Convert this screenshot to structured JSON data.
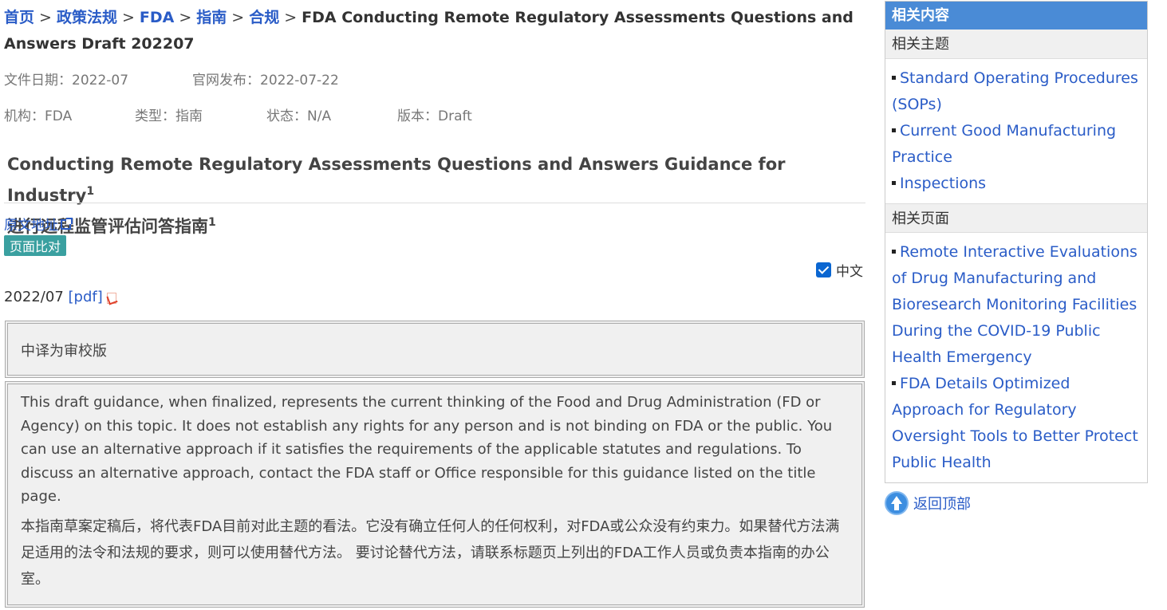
{
  "breadcrumb": {
    "home": "首页",
    "policy": "政策法规",
    "fda": "FDA",
    "guide": "指南",
    "compliance": "合规",
    "sep": ">",
    "current": "FDA Conducting Remote Regulatory Assessments Questions and Answers Draft 202207"
  },
  "meta": {
    "doc_date": "文件日期：2022-07",
    "published": "官网发布：2022-07-22",
    "agency": "机构：FDA",
    "type": "类型：指南",
    "status": "状态：N/A",
    "version": "版本：Draft"
  },
  "doc": {
    "title_en": "Conducting Remote Regulatory Assessments Questions and Answers Guidance for Industry",
    "title_zh": "进行远程监管评估问答指南",
    "footnote": "1",
    "original_link": "原文地址",
    "compare_button": "页面比对",
    "lang_label": "中文",
    "date": "2022/07",
    "pdf_link": "[pdf]"
  },
  "notice": {
    "review_note": "中译为审校版",
    "disclaimer_en": "This draft guidance, when finalized, represents the current thinking of the Food and Drug Administration (FD or Agency) on this topic. It does not establish any rights for any person and is not binding on FDA or the public. You can use an alternative approach if it satisfies the requirements of the applicable statutes and regulations. To discuss an alternative approach, contact the FDA staff or Office responsible for this guidance listed on the title page.",
    "disclaimer_zh": "本指南草案定稿后，将代表FDA目前对此主题的看法。它没有确立任何人的任何权利，对FDA或公众没有约束力。如果替代方法满足适用的法令和法规的要求，则可以使用替代方法。 要讨论替代方法，请联系标题页上列出的FDA工作人员或负责本指南的办公室。"
  },
  "sidebar": {
    "heading": "相关内容",
    "topics_heading": "相关主题",
    "topics": [
      "Standard Operating Procedures (SOPs)",
      "Current Good Manufacturing Practice",
      "Inspections"
    ],
    "pages_heading": "相关页面",
    "pages": [
      "Remote Interactive Evaluations of Drug Manufacturing and Bioresearch Monitoring Facilities During the COVID-19 Public Health Emergency",
      "FDA Details Optimized Approach for Regulatory Oversight Tools to Better Protect Public Health"
    ],
    "back_to_top": "返回顶部"
  },
  "colors": {
    "link": "#2a5cc7",
    "sidebar_header": "#4a8bd6",
    "compare_button": "#3aa0a0",
    "checkbox": "#0a66d1"
  }
}
